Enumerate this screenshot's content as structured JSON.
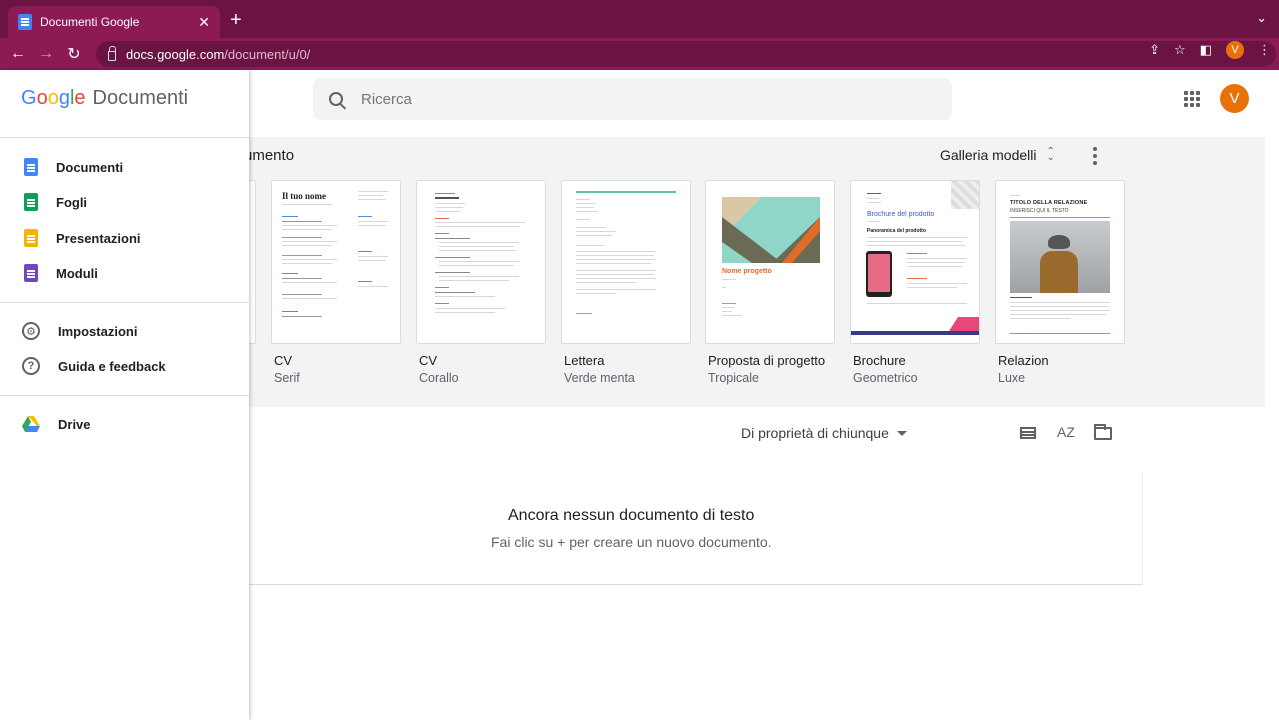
{
  "browser": {
    "tab_title": "Documenti Google",
    "url_host": "docs.google.com",
    "url_path": "/document/u/0/",
    "profile_initial": "V"
  },
  "header": {
    "search_placeholder": "Ricerca",
    "avatar_initial": "V"
  },
  "templates": {
    "title": "umento",
    "gallery_label": "Galleria modelli",
    "items": [
      {
        "name": "CV",
        "sub": "Serif"
      },
      {
        "name": "CV",
        "sub": "Corallo"
      },
      {
        "name": "Lettera",
        "sub": "Verde menta"
      },
      {
        "name": "Proposta di progetto",
        "sub": "Tropicale"
      },
      {
        "name": "Brochure",
        "sub": "Geometrico"
      },
      {
        "name": "Relazion",
        "sub": "Luxe"
      }
    ],
    "thumb_texts": {
      "cv_serif_name": "Il tuo nome",
      "proposal_name": "Nome progetto",
      "brochure_title": "Brochure del prodotto",
      "brochure_sub": "Panoramica del prodotto",
      "report_title": "TITOLO DELLA RELAZIONE",
      "report_sub": "INSERISCI QUI IL TESTO"
    }
  },
  "documents": {
    "owner_filter": "Di proprietà di chiunque",
    "sort_label": "AZ",
    "empty_title": "Ancora nessun documento di testo",
    "empty_sub": "Fai clic su + per creare un nuovo documento."
  },
  "drawer": {
    "logo": {
      "G": "G",
      "o1": "o",
      "o2": "o",
      "g": "g",
      "l": "l",
      "e": "e"
    },
    "product": "Documenti",
    "apps": [
      {
        "label": "Documenti",
        "color": "#4285f4"
      },
      {
        "label": "Fogli",
        "color": "#0f9d58"
      },
      {
        "label": "Presentazioni",
        "color": "#f4b400"
      },
      {
        "label": "Moduli",
        "color": "#7248b9"
      }
    ],
    "settings_label": "Impostazioni",
    "help_label": "Guida e feedback",
    "drive_label": "Drive"
  }
}
